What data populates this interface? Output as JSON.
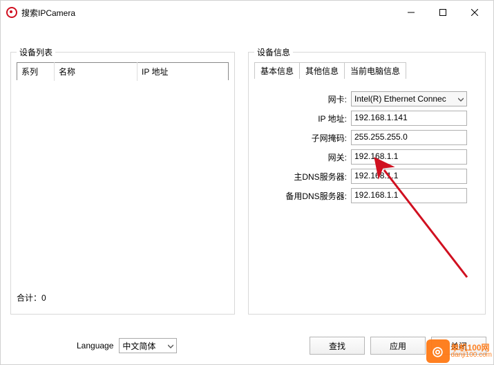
{
  "window": {
    "title": "搜索IPCamera"
  },
  "device_list": {
    "legend": "设备列表",
    "columns": {
      "series": "系列",
      "name": "名称",
      "ip": "IP 地址"
    },
    "rows": [],
    "footer_label": "合计：",
    "footer_count": "0"
  },
  "device_info": {
    "legend": "设备信息",
    "tabs": {
      "basic": "基本信息",
      "other": "其他信息",
      "current": "当前电脑信息"
    },
    "active_tab": "current",
    "fields": {
      "nic_label": "网卡:",
      "nic_value": "Intel(R) Ethernet Connec",
      "ip_label": "IP 地址:",
      "ip_value": "192.168.1.141",
      "mask_label": "子网掩码:",
      "mask_value": "255.255.255.0",
      "gateway_label": "网关:",
      "gateway_value": "192.168.1.1",
      "dns1_label": "主DNS服务器:",
      "dns1_value": "192.168.1.1",
      "dns2_label": "备用DNS服务器:",
      "dns2_value": "192.168.1.1"
    }
  },
  "bottom": {
    "language_label": "Language",
    "language_value": "中文简体",
    "buttons": {
      "search": "查找",
      "apply": "应用",
      "close": "关闭"
    }
  },
  "watermark": {
    "cn": "单机100网",
    "url": "danji100.com"
  }
}
